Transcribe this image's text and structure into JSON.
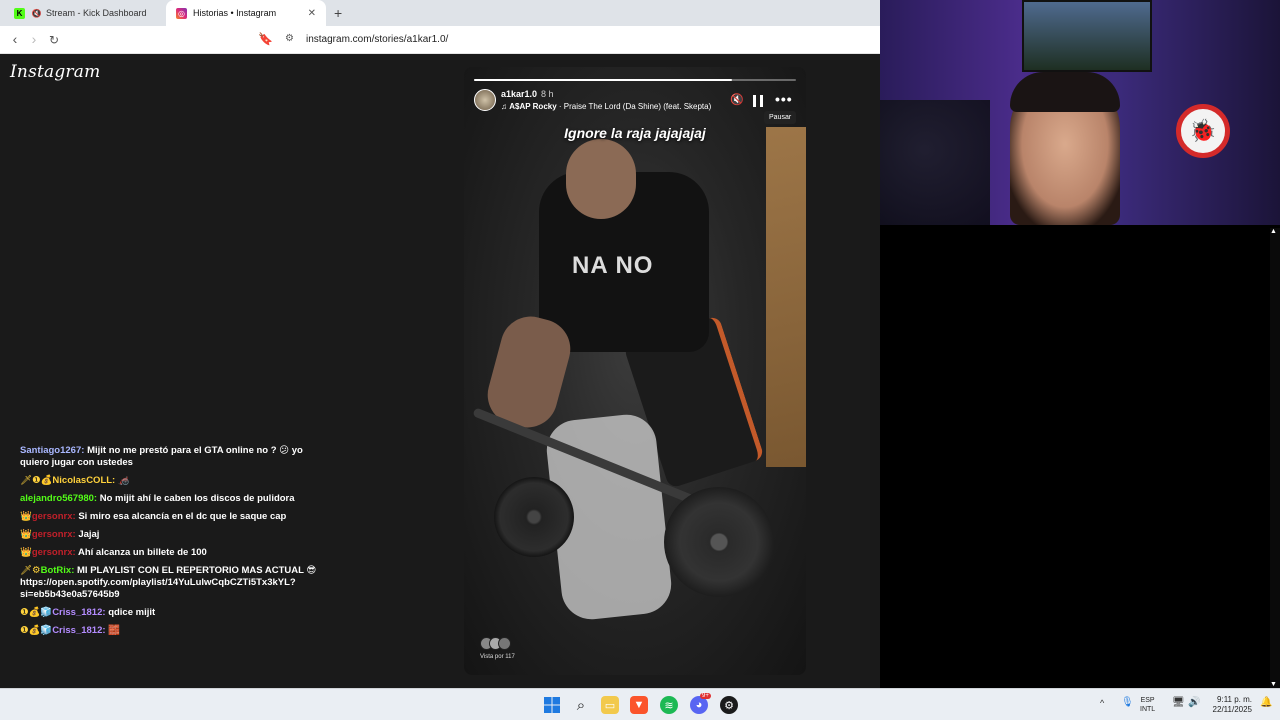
{
  "browser": {
    "tabs": [
      {
        "title": "Stream - Kick Dashboard",
        "favicon": "kick-icon",
        "favicon_color": "#53fc18",
        "active": false
      },
      {
        "title": "Historias • Instagram",
        "favicon": "instagram-icon",
        "favicon_color": "#e1306c",
        "active": true
      }
    ],
    "new_tab": "+",
    "url": "instagram.com/stories/a1kar1.0/"
  },
  "instagram": {
    "logo": "Instagram",
    "story": {
      "username": "a1kar1.0",
      "time_ago": "8 h",
      "music_artist": "A$AP Rocky",
      "music_sep": " · ",
      "music_title": "Praise The Lord (Da Shine) (feat. Skepta)",
      "caption": "Ignore la raja jajajajaj",
      "tooltip": "Pausar",
      "more": "•••",
      "views": "Vista por 117",
      "progress_percent": 80,
      "printed_text": "NA NO"
    }
  },
  "chat": {
    "messages": [
      {
        "badges": "",
        "user": "Santiago1267:",
        "user_color": "#a9b7ff",
        "text": "Mijit no me prestó para el GTA online no ? 😕 yo quiero jugar con ustedes"
      },
      {
        "badges": "🗡❶💰",
        "user": "NicolasCOLL:",
        "user_color": "#ffd23c",
        "text": "🦽"
      },
      {
        "badges": "",
        "user": "alejandro567980:",
        "user_color": "#53fc18",
        "text": "No mijit ahí le caben los discos de pulidora"
      },
      {
        "badges": "👑",
        "user": "gersonrx:",
        "user_color": "#c0202a",
        "text": "Si miro esa alcancía en el dc que le saque cap"
      },
      {
        "badges": "👑",
        "user": "gersonrx:",
        "user_color": "#c0202a",
        "text": "Jajaj"
      },
      {
        "badges": "👑",
        "user": "gersonrx:",
        "user_color": "#c0202a",
        "text": "Ahí alcanza un billete de 100"
      },
      {
        "badges": "🗡⚙",
        "user": "BotRix:",
        "user_color": "#53fc18",
        "text": "MI PLAYLIST CON EL REPERTORIO MAS ACTUAL 😎 https://open.spotify.com/playlist/14YuLulwCqbCZTi5Tx3kYL?si=eb5b43e0a57645b9"
      },
      {
        "badges": "❶💰🧊",
        "user": "Criss_1812:",
        "user_color": "#b48cff",
        "text": "qdice mijit"
      },
      {
        "badges": "❶💰🧊",
        "user": "Criss_1812:",
        "user_color": "#b48cff",
        "text": "🧱"
      }
    ]
  },
  "taskbar": {
    "lang_top": "ESP",
    "lang_bottom": "INTL",
    "time": "9:11 p. m.",
    "date": "22/11/2025",
    "apps": [
      "windows-start-icon",
      "search-icon",
      "file-explorer-icon",
      "brave-icon",
      "spotify-icon",
      "discord-icon",
      "steam-icon"
    ],
    "discord_badge": "9+"
  }
}
